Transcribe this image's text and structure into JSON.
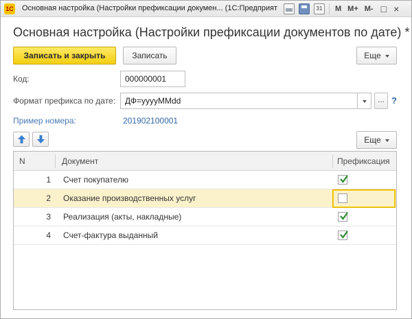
{
  "window": {
    "logo": "1С",
    "title": "Основная настройка (Настройки префиксации докумен...   (1С:Предприятие)",
    "m1": "M",
    "m2": "M+",
    "m3": "M-",
    "calendar_day": "31",
    "restore_glyph": "□",
    "close_glyph": "×"
  },
  "form": {
    "title": "Основная настройка (Настройки префиксации документов по дате) *"
  },
  "toolbar": {
    "save_close_label": "Записать и закрыть",
    "save_label": "Записать",
    "more_label": "Еще"
  },
  "fields": {
    "code_label": "Код:",
    "code_value": "000000001",
    "format_label": "Формат префикса по дате:",
    "format_value": "ДФ=yyyyMMdd",
    "format_dots": "...",
    "help_mark": "?",
    "example_label": "Пример номера:",
    "example_value": "201902100001"
  },
  "table": {
    "more_label": "Еще",
    "columns": {
      "n": "N",
      "document": "Документ",
      "prefix": "Префиксация"
    },
    "rows": [
      {
        "n": "1",
        "document": "Счет покупателю",
        "checked": true
      },
      {
        "n": "2",
        "document": "Оказание производственных услуг",
        "checked": false
      },
      {
        "n": "3",
        "document": "Реализация (акты, накладные)",
        "checked": true
      },
      {
        "n": "4",
        "document": "Счет-фактура выданный",
        "checked": true
      }
    ]
  },
  "colors": {
    "accent_yellow": "#f3cf10",
    "selected_row": "#fbf2cc",
    "link_blue": "#2f67a8",
    "check_green": "#2e8b2e"
  }
}
